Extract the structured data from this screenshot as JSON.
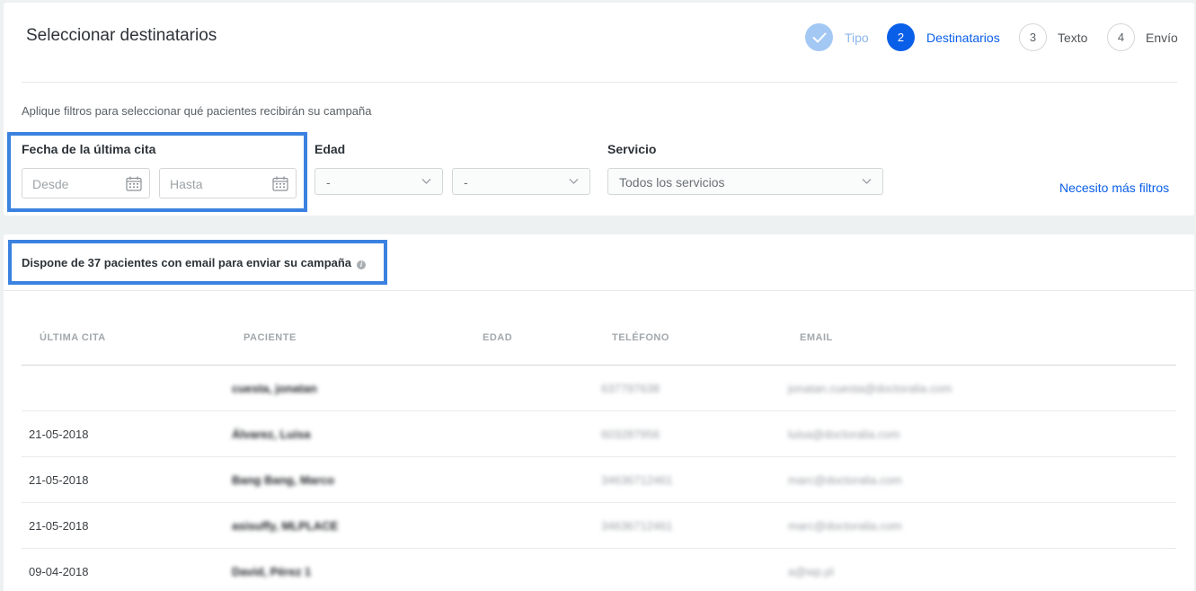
{
  "header": {
    "title": "Seleccionar destinatarios"
  },
  "steps": [
    {
      "number": "",
      "label": "Tipo",
      "state": "done"
    },
    {
      "number": "2",
      "label": "Destinatarios",
      "state": "active"
    },
    {
      "number": "3",
      "label": "Texto",
      "state": "pending"
    },
    {
      "number": "4",
      "label": "Envío",
      "state": "pending"
    }
  ],
  "filters": {
    "hint": "Aplique filtros para seleccionar qué pacientes recibirán su campaña",
    "fecha": {
      "label": "Fecha de la última cita",
      "desde_placeholder": "Desde",
      "hasta_placeholder": "Hasta"
    },
    "edad": {
      "label": "Edad",
      "min_value": "-",
      "max_value": "-"
    },
    "servicio": {
      "label": "Servicio",
      "value": "Todos los servicios"
    },
    "more_link": "Necesito más filtros"
  },
  "summary": {
    "text": "Dispone de 37 pacientes con email para enviar su campaña",
    "info_icon": "info-icon"
  },
  "table": {
    "headers": [
      "ÚLTIMA CITA",
      "PACIENTE",
      "EDAD",
      "TELÉFONO",
      "EMAIL"
    ],
    "rows": [
      {
        "fecha": "",
        "paciente": "cuesta, jonatan",
        "edad": "",
        "telefono": "637797638",
        "email": "jonatan.cuesta@doctoralia.com"
      },
      {
        "fecha": "21-05-2018",
        "paciente": "Álvarez, Luisa",
        "edad": "",
        "telefono": "603287956",
        "email": "luisa@doctoralia.com"
      },
      {
        "fecha": "21-05-2018",
        "paciente": "Bang Bang, Marco",
        "edad": "",
        "telefono": "34636712461",
        "email": "marc@doctoralia.com"
      },
      {
        "fecha": "21-05-2018",
        "paciente": "asisuffy, MLPLACE",
        "edad": "",
        "telefono": "34636712461",
        "email": "marc@doctoralia.com"
      },
      {
        "fecha": "09-04-2018",
        "paciente": "David, Pérez 1",
        "edad": "",
        "telefono": "",
        "email": "a@wp.pl"
      }
    ]
  },
  "colors": {
    "accent": "#0a5fe8",
    "highlight": "#3b82e0",
    "step_done": "#a3c8f4"
  }
}
